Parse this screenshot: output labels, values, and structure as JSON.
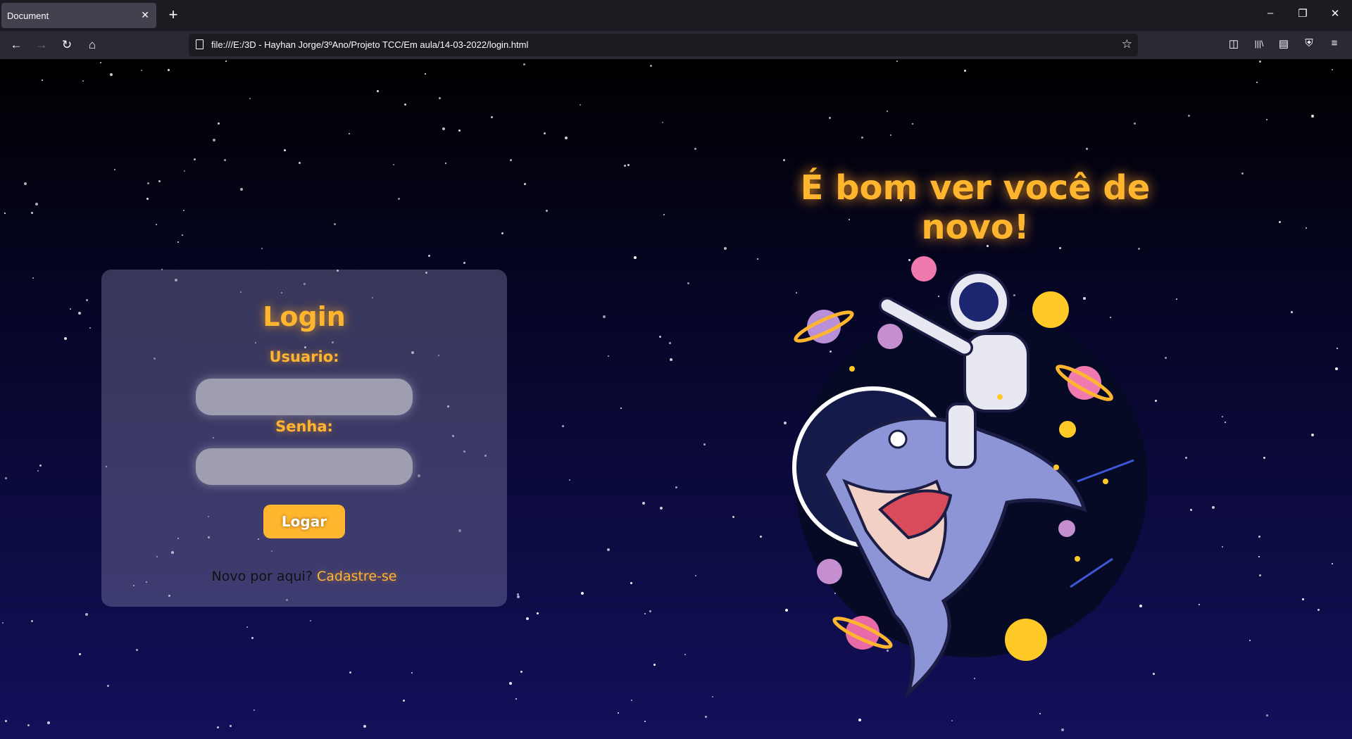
{
  "browser": {
    "tab_title": "Document",
    "tab_close": "✕",
    "new_tab": "+",
    "url": "file:///E:/3D - Hayhan Jorge/3ºAno/Projeto TCC/Em aula/14-03-2022/login.html",
    "icons": {
      "back": "←",
      "forward": "→",
      "reload": "↻",
      "home": "⌂",
      "star": "☆",
      "pocket": "◫",
      "library": "|||\\",
      "sidebar": "▤",
      "shield": "⛨",
      "menu": "≡",
      "minimize": "–",
      "restore": "❐",
      "close": "✕"
    }
  },
  "login": {
    "title": "Login",
    "username_label": "Usuario:",
    "username_value": "",
    "password_label": "Senha:",
    "password_value": "",
    "submit_label": "Logar",
    "signup_prompt": "Novo por aqui? ",
    "signup_link": "Cadastre-se"
  },
  "hero": {
    "welcome": "É bom ver você de novo!"
  },
  "colors": {
    "accent": "#ffb52e",
    "card": "#5a587e",
    "bg_top": "#000000",
    "bg_bottom": "#12105a"
  }
}
